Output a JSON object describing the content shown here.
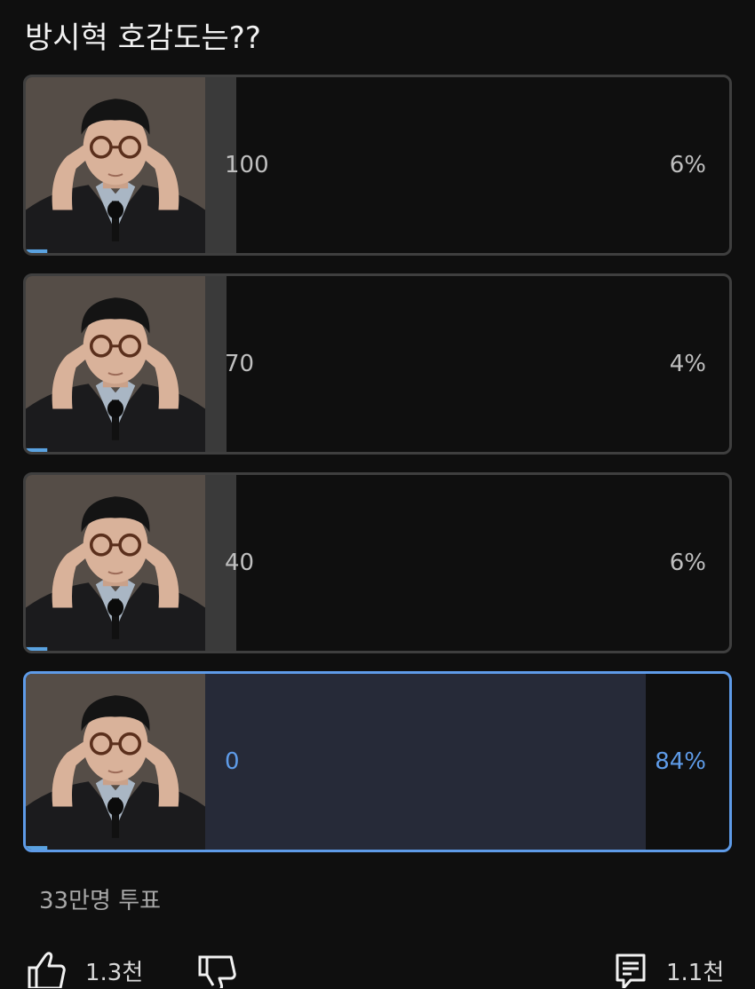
{
  "poll": {
    "question": "방시혁 호감도는??",
    "options": [
      {
        "label": "100",
        "percent_text": "6%",
        "percent": 6,
        "selected": false
      },
      {
        "label": "70",
        "percent_text": "4%",
        "percent": 4,
        "selected": false
      },
      {
        "label": "40",
        "percent_text": "6%",
        "percent": 6,
        "selected": false
      },
      {
        "label": "0",
        "percent_text": "84%",
        "percent": 84,
        "selected": true
      }
    ],
    "vote_count": "33만명 투표"
  },
  "actions": {
    "like_count": "1.3천",
    "comment_count": "1.1천"
  },
  "colors": {
    "background": "#0f0f0f",
    "border": "#3f3f3f",
    "selected_accent": "#5e9be8",
    "bar_fill": "#3a3a3a",
    "selected_fill": "#262a38"
  },
  "icons": {
    "like": "thumbs-up-icon",
    "dislike": "thumbs-down-icon",
    "comment": "comment-icon"
  }
}
